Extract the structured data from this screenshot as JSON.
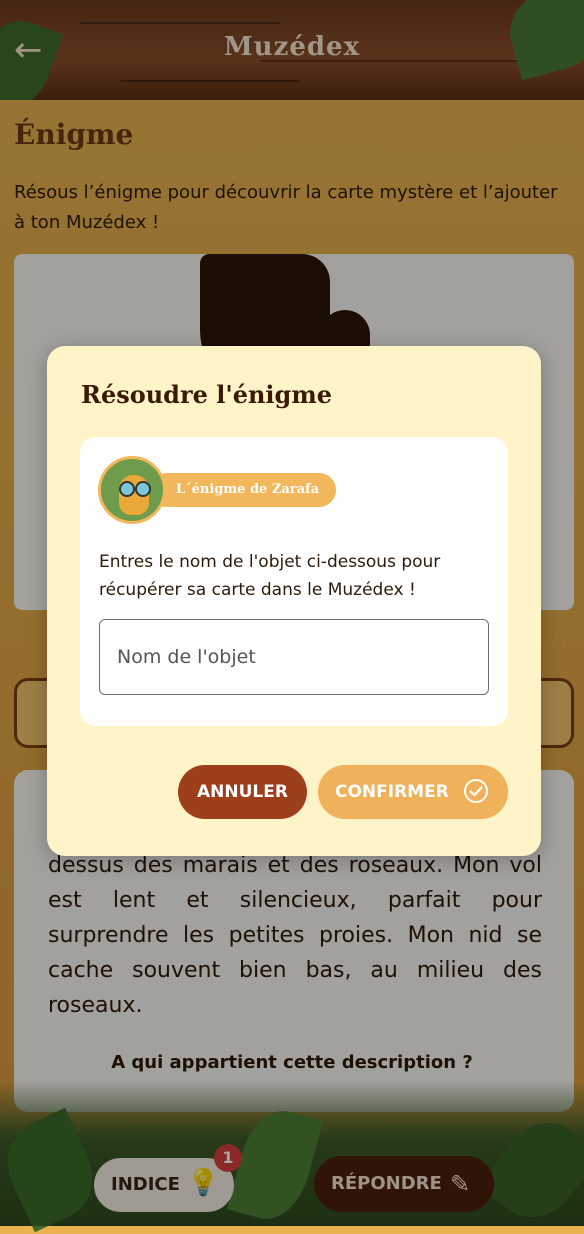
{
  "header": {
    "title": "Muzédex",
    "back_icon": "arrow-left-icon"
  },
  "page": {
    "heading": "Énigme",
    "intro": "Résous l’énigme pour découvrir la carte mystère et l’ajouter à ton Muzédex !",
    "description": "dessus des marais et des roseaux. Mon vol est lent et silencieux, parfait pour surprendre les petites proies. Mon nid se cache souvent bien bas, au milieu des roseaux.",
    "question": "A qui appartient cette description ?"
  },
  "bottom": {
    "hint_label": "INDICE",
    "hint_badge": "1",
    "answer_label": "RÉPONDRE"
  },
  "dialog": {
    "title": "Résoudre l'énigme",
    "riddle_tag": "L´énigme de Zarafa",
    "message": "Entres le nom de l'objet ci-dessous pour récupérer sa carte dans le Muzédex !",
    "input_placeholder": "Nom de l'objet",
    "input_value": "",
    "cancel_label": "ANNULER",
    "confirm_label": "CONFIRMER"
  },
  "colors": {
    "dialog_bg": "#fef4c8",
    "cancel_bg": "#9d3f1a",
    "confirm_bg": "#efb15a",
    "tag_bg": "#f2b75a"
  }
}
